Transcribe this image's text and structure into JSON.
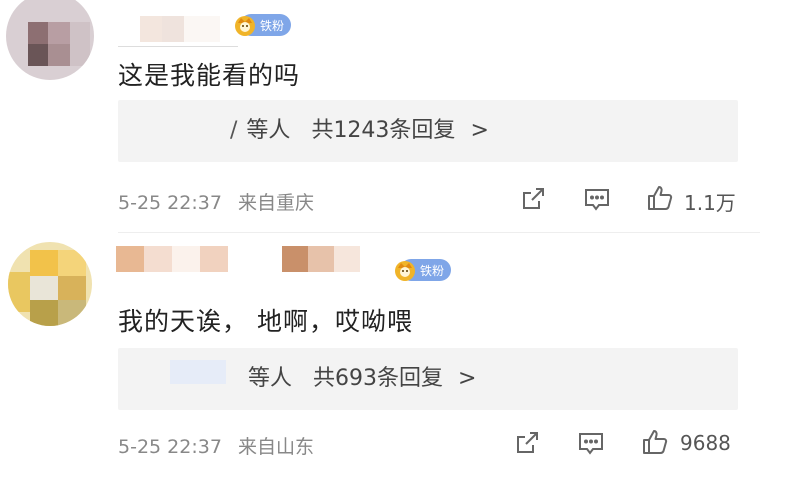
{
  "comments": [
    {
      "badge": "铁粉",
      "text": "这是我能看的吗",
      "replies": {
        "prefix": "/",
        "label": "等人",
        "total": "共1243条回复",
        "arrow": ">"
      },
      "date": "5-25 22:37",
      "location": "来自重庆",
      "likes": "1.1万"
    },
    {
      "badge": "铁粉",
      "text": "我的天诶， 地啊，哎呦喂",
      "replies": {
        "prefix": "",
        "label": "等人",
        "total": "共693条回复",
        "arrow": ">"
      },
      "date": "5-25 22:37",
      "location": "来自山东",
      "likes": "9688"
    }
  ],
  "icons": [
    "share-icon",
    "comment-icon",
    "like-icon"
  ],
  "colors": {
    "badge": "#7fa6e8",
    "reply_bg": "#f3f3f3",
    "meta_text": "#888888"
  }
}
